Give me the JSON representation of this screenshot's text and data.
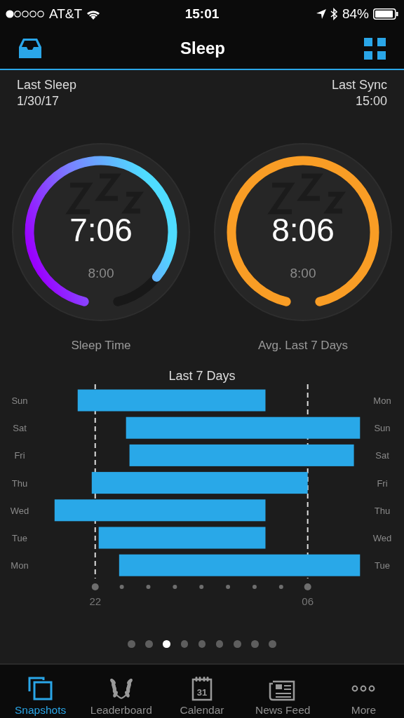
{
  "status_bar": {
    "carrier": "AT&T",
    "time": "15:01",
    "battery": "84%"
  },
  "nav": {
    "title": "Sleep"
  },
  "header": {
    "left_label": "Last Sleep",
    "left_value": "1/30/17",
    "right_label": "Last Sync",
    "right_value": "15:00"
  },
  "gauges": [
    {
      "kind": "gradient",
      "value": "7:06",
      "goal": "8:00",
      "label": "Sleep Time"
    },
    {
      "kind": "solid",
      "value": "8:06",
      "goal": "8:00",
      "label": "Avg. Last 7 Days"
    }
  ],
  "sleep_chart": {
    "title": "Last 7 Days",
    "rows": [
      {
        "day": "Sun",
        "wake_day": "Mon"
      },
      {
        "day": "Sat",
        "wake_day": "Sun"
      },
      {
        "day": "Fri",
        "wake_day": "Sat"
      },
      {
        "day": "Thu",
        "wake_day": "Fri"
      },
      {
        "day": "Wed",
        "wake_day": "Thu"
      },
      {
        "day": "Tue",
        "wake_day": "Wed"
      },
      {
        "day": "Mon",
        "wake_day": "Tue"
      }
    ],
    "axis_labels": [
      "22",
      "06"
    ]
  },
  "pager": [
    {
      "selected": false
    },
    {
      "selected": false
    },
    {
      "selected": true
    },
    {
      "selected": false
    },
    {
      "selected": false
    },
    {
      "selected": false
    },
    {
      "selected": false
    },
    {
      "selected": false
    },
    {
      "selected": false
    }
  ],
  "tabs": [
    {
      "kind": "snapshots",
      "label": "Snapshots",
      "selected": true
    },
    {
      "kind": "leaderboard",
      "label": "Leaderboard",
      "selected": false
    },
    {
      "kind": "calendar",
      "label": "Calendar",
      "icon_text": "31",
      "selected": false
    },
    {
      "kind": "news",
      "label": "News Feed",
      "selected": false
    },
    {
      "kind": "more",
      "label": "More",
      "selected": false
    }
  ]
}
